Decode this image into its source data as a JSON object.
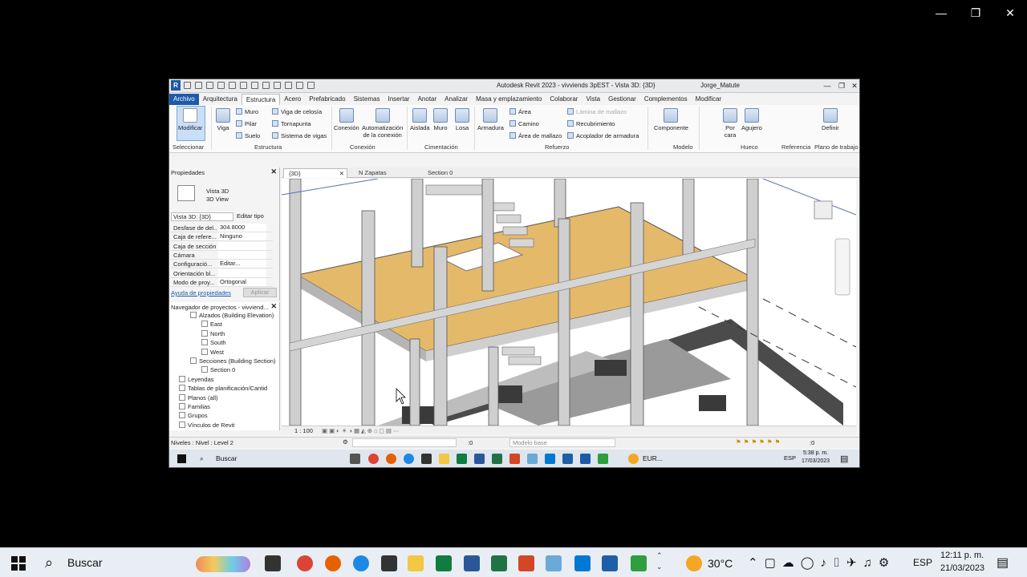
{
  "window": {
    "title": "Autodesk Revit 2023 - vivviends 3pEST - Vista 3D: {3D}",
    "user": "Jorge_Matute"
  },
  "ribbon_tabs": [
    "Archivo",
    "Arquitectura",
    "Estructura",
    "Acero",
    "Prefabricado",
    "Sistemas",
    "Insertar",
    "Anotar",
    "Analizar",
    "Masa y emplazamiento",
    "Colaborar",
    "Vista",
    "Gestionar",
    "Complementos",
    "Modificar"
  ],
  "ribbon": {
    "modificar": "Modificar",
    "viga": "Viga",
    "muro_s": "Muro",
    "pilar": "Pilar",
    "suelo": "Suelo",
    "viga_celosia": "Viga de celosía",
    "tornapunta": "Tornapunta",
    "sistema_vigas": "Sistema de vigas",
    "conexion": "Conexión",
    "automatizacion": "Automatización",
    "de_la_conexion": "de la conexión",
    "aislada": "Aislada",
    "muro": "Muro",
    "losa": "Losa",
    "armadura": "Armadura",
    "area": "Área",
    "camino": "Camino",
    "area_malla": "Área de mallazo",
    "lamina": "Lámina de mallazo",
    "recubrimiento": "Recubrimiento",
    "acoplador": "Acoplador de armadura",
    "componente": "Componente",
    "por_cara": "Por",
    "cara": "cara",
    "agujero": "Agujero",
    "definir": "Definir",
    "groups": {
      "seleccionar": "Seleccionar",
      "estructura": "Estructura",
      "conexion": "Conexión",
      "cimentacion": "Cimentación",
      "refuerzo": "Refuerzo",
      "modelo": "Modelo",
      "hueco": "Hueco",
      "referencia": "Referencia",
      "plano": "Plano de trabajo"
    }
  },
  "properties": {
    "header": "Propiedades",
    "type_line1": "Vista 3D",
    "type_line2": "3D View",
    "selector": "Vista 3D: {3D}",
    "edit_type": "Editar tipo",
    "rows": [
      {
        "k": "Desfase de del...",
        "v": "304.8000"
      },
      {
        "k": "Caja de refere...",
        "v": "Ninguno"
      },
      {
        "k": "Caja de sección",
        "v": ""
      },
      {
        "k": "Cámara",
        "v": ""
      },
      {
        "k": "Configuració...",
        "v": "Editar..."
      },
      {
        "k": "Orientación bl...",
        "v": ""
      },
      {
        "k": "Modo de proy...",
        "v": "Ortogonal"
      }
    ],
    "help": "Ayuda de propiedades",
    "apply": "Aplicar"
  },
  "navigator": {
    "header": "Navegador de proyectos - vivviend...",
    "items": [
      {
        "label": "Alzados (Building Elevation)",
        "level": 1
      },
      {
        "label": "East",
        "level": 2
      },
      {
        "label": "North",
        "level": 2
      },
      {
        "label": "South",
        "level": 2
      },
      {
        "label": "West",
        "level": 2
      },
      {
        "label": "Secciones (Building Section)",
        "level": 1
      },
      {
        "label": "Section 0",
        "level": 2
      },
      {
        "label": "Leyendas",
        "level": 0
      },
      {
        "label": "Tablas de planificación/Cantid",
        "level": 0
      },
      {
        "label": "Planos (all)",
        "level": 0
      },
      {
        "label": "Familias",
        "level": 0
      },
      {
        "label": "Grupos",
        "level": 0
      },
      {
        "label": "Vínculos de Revit",
        "level": 0
      }
    ]
  },
  "view_tabs": [
    "{3D}",
    "N Zapatas",
    "Section 0"
  ],
  "view_bar": {
    "scale": "1 : 100"
  },
  "status": {
    "text": "Niveles : Nivel : Level 2",
    "count": ":0",
    "model": "Modelo base",
    "filter": ":0"
  },
  "inner_taskbar": {
    "search": "Buscar",
    "currency": "EUR...",
    "lang": "ESP",
    "time": "5:38 p. m.",
    "date": "17/03/2023"
  },
  "taskbar": {
    "search": "Buscar",
    "temp": "30°C",
    "lang": "ESP",
    "time": "12:11 p. m.",
    "date": "21/03/2023"
  }
}
